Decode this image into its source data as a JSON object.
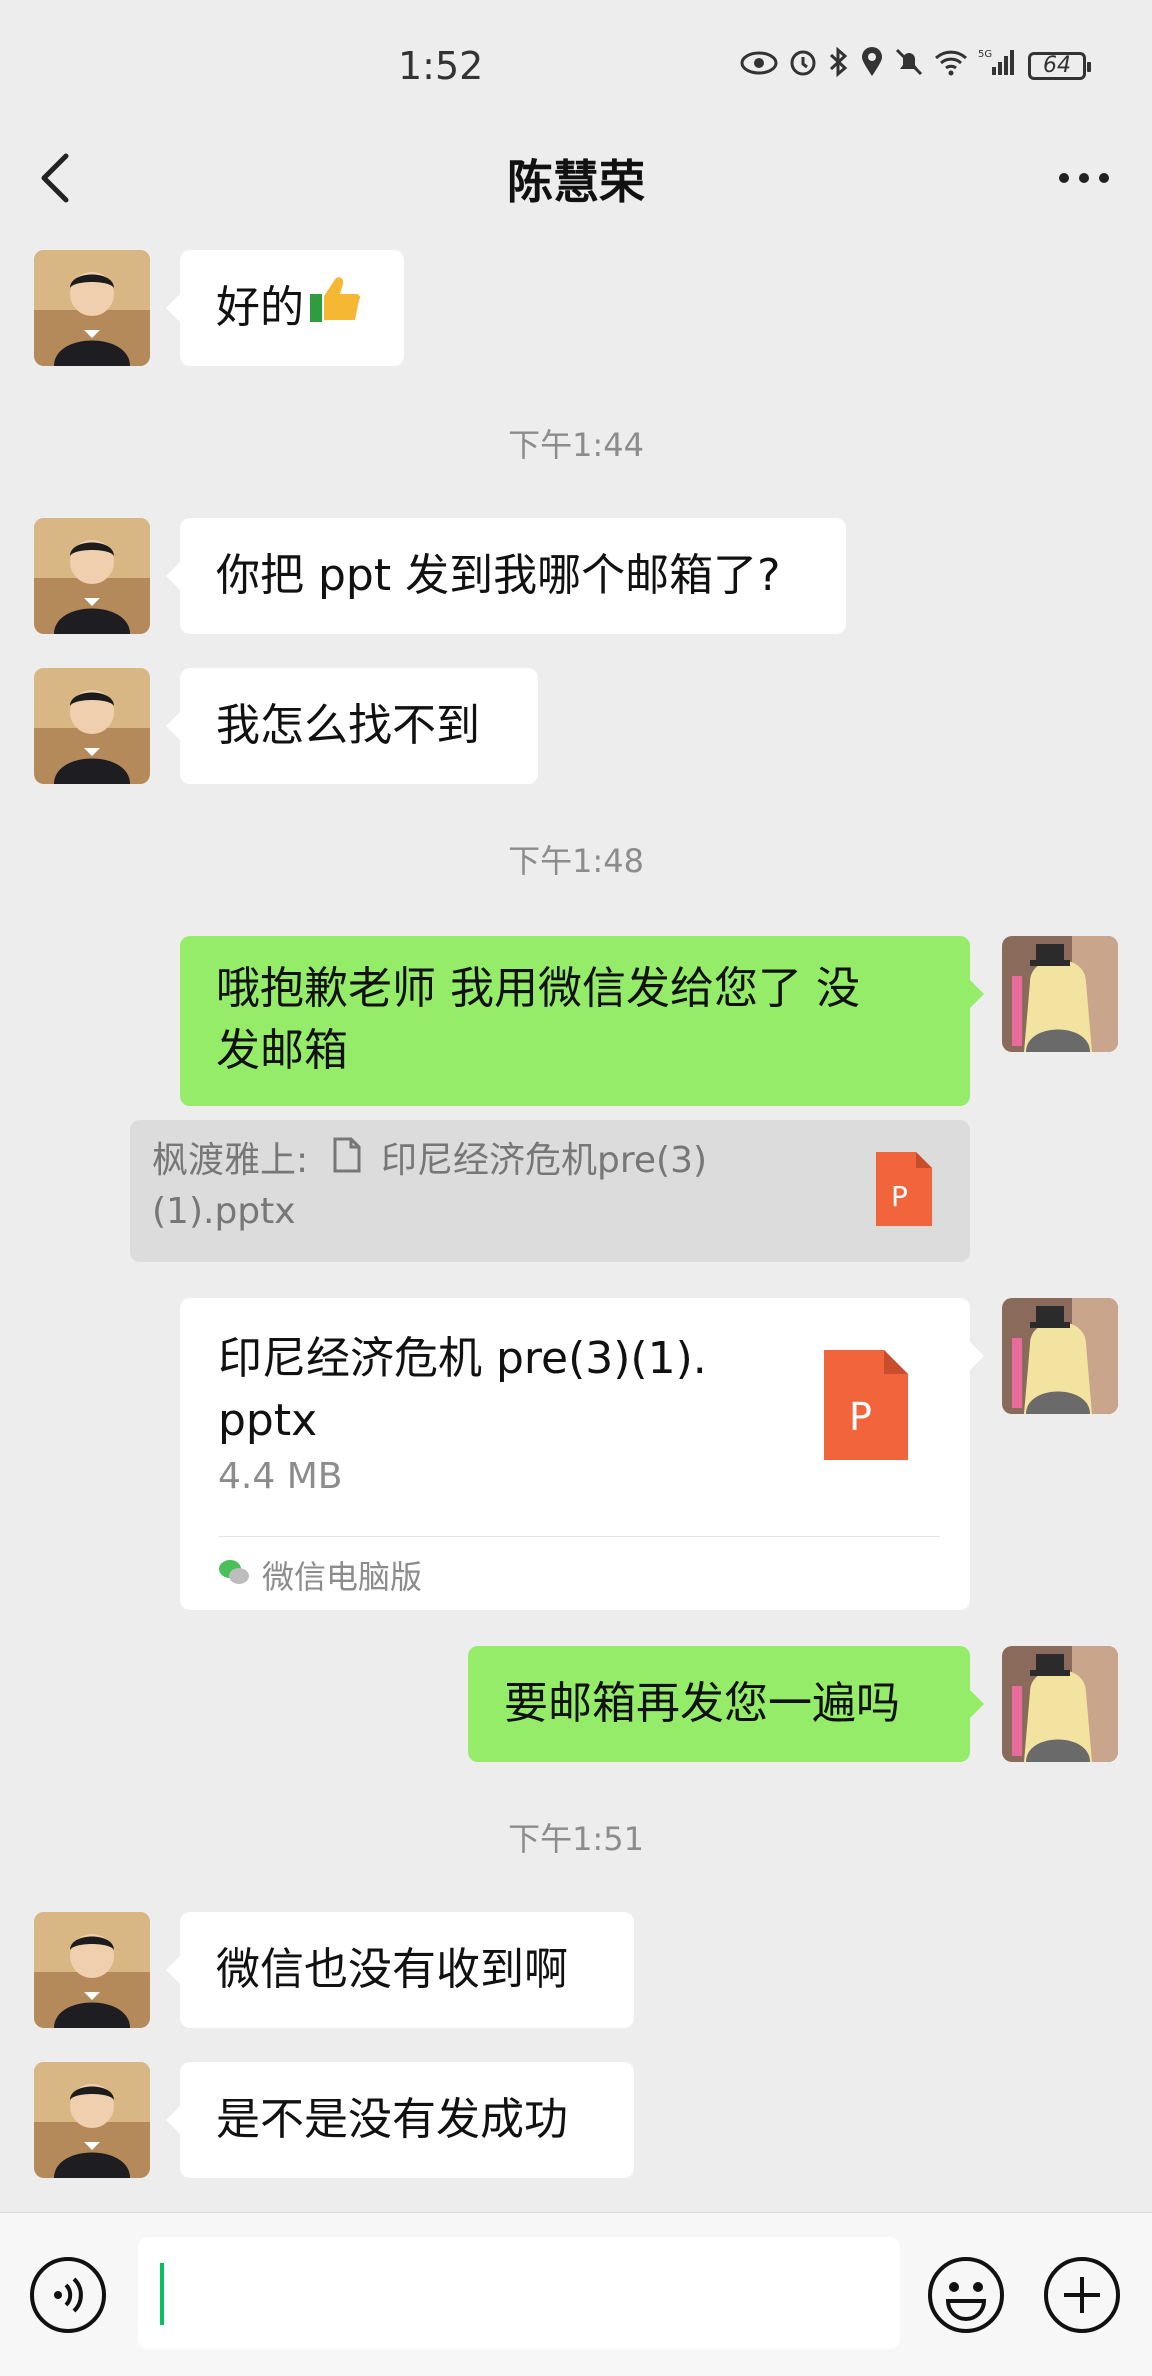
{
  "status_bar": {
    "time": "1:52",
    "battery": "64",
    "icons": [
      "eye-icon",
      "alarm-icon",
      "bluetooth-icon",
      "location-icon",
      "mute-icon",
      "wifi-icon",
      "signal-5g-icon"
    ]
  },
  "header": {
    "title": "陈慧荣",
    "back_icon": "chevron-left-icon",
    "more_icon": "more-icon"
  },
  "messages": [
    {
      "from": "contact",
      "text": "好的"
    },
    {
      "type": "time",
      "text": "下午1:44"
    },
    {
      "from": "contact",
      "text": "你把 ppt 发到我哪个邮箱了?"
    },
    {
      "from": "contact",
      "text": "我怎么找不到"
    },
    {
      "type": "time",
      "text": "下午1:48"
    },
    {
      "from": "me",
      "line1": "哦抱歉老师 我用微信发给您了 没",
      "line2": "发邮箱"
    },
    {
      "type": "quote",
      "author": "枫渡雅上:",
      "file_line1": "印尼经济危机pre(3)",
      "file_line2": "(1).pptx"
    },
    {
      "type": "file",
      "from": "me",
      "name_line1": "印尼经济危机 pre(3)(1).",
      "name_line2": "pptx",
      "size": "4.4 MB",
      "source": "微信电脑版"
    },
    {
      "from": "me",
      "text": "要邮箱再发您一遍吗"
    },
    {
      "type": "time",
      "text": "下午1:51"
    },
    {
      "from": "contact",
      "text": "微信也没有收到啊"
    },
    {
      "from": "contact",
      "text": "是不是没有发成功"
    }
  ],
  "ppt_badge": "P",
  "colors": {
    "background": "#ededed",
    "outgoing_bubble": "#95ec69",
    "incoming_bubble": "#ffffff",
    "ppt_orange": "#f1643c",
    "cursor": "#07c160"
  }
}
